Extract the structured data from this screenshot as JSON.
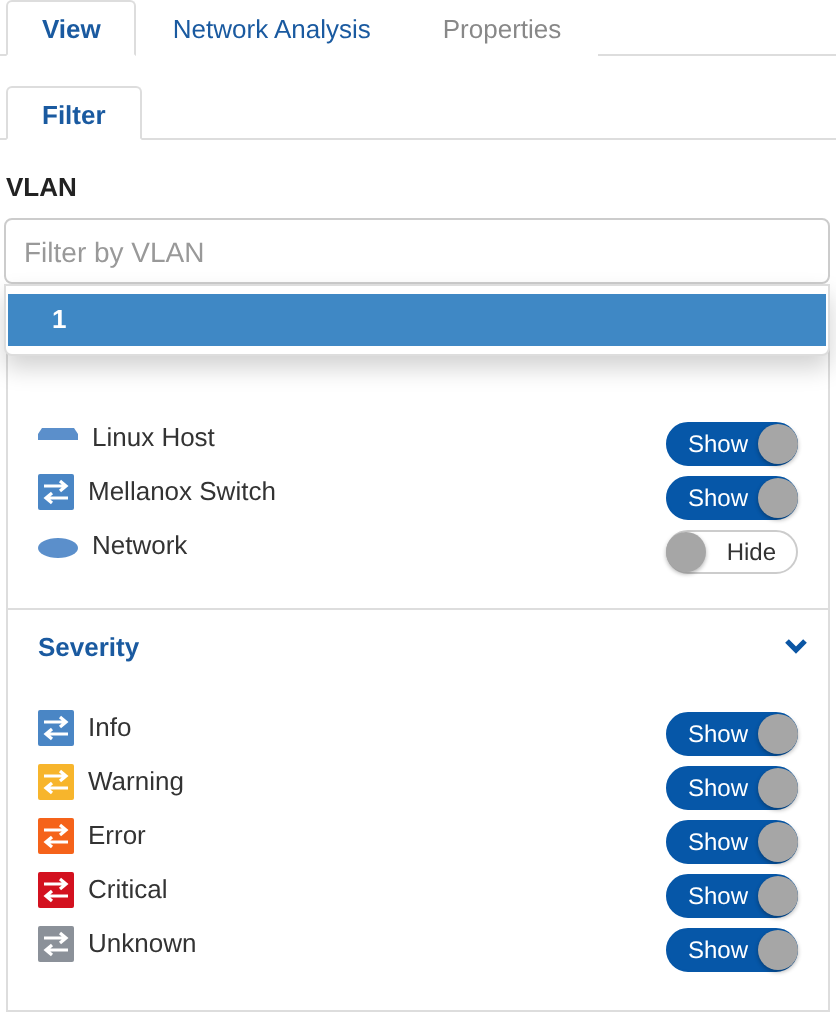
{
  "tabs": [
    {
      "label": "View",
      "selected": true,
      "disabled": false
    },
    {
      "label": "Network Analysis",
      "selected": false,
      "disabled": false
    },
    {
      "label": "Properties",
      "selected": false,
      "disabled": true
    }
  ],
  "subtabs": [
    {
      "label": "Filter",
      "selected": true
    }
  ],
  "vlan": {
    "label": "VLAN",
    "placeholder": "Filter by VLAN",
    "options": [
      {
        "label": "1",
        "selected": true
      }
    ]
  },
  "type_items": [
    {
      "kind": "host",
      "label": "Linux Host",
      "on": true,
      "toggle_text": "Show"
    },
    {
      "kind": "switch",
      "label": "Mellanox Switch",
      "on": true,
      "toggle_text": "Show"
    },
    {
      "kind": "cloud",
      "label": "Network",
      "on": false,
      "toggle_text": "Hide"
    }
  ],
  "severity": {
    "title": "Severity",
    "expanded": true,
    "items": [
      {
        "label": "Info",
        "color": "#4a86c5",
        "on": true,
        "toggle_text": "Show"
      },
      {
        "label": "Warning",
        "color": "#f7b52c",
        "on": true,
        "toggle_text": "Show"
      },
      {
        "label": "Error",
        "color": "#f5631a",
        "on": true,
        "toggle_text": "Show"
      },
      {
        "label": "Critical",
        "color": "#d3111f",
        "on": true,
        "toggle_text": "Show"
      },
      {
        "label": "Unknown",
        "color": "#8b9199",
        "on": true,
        "toggle_text": "Show"
      }
    ]
  }
}
